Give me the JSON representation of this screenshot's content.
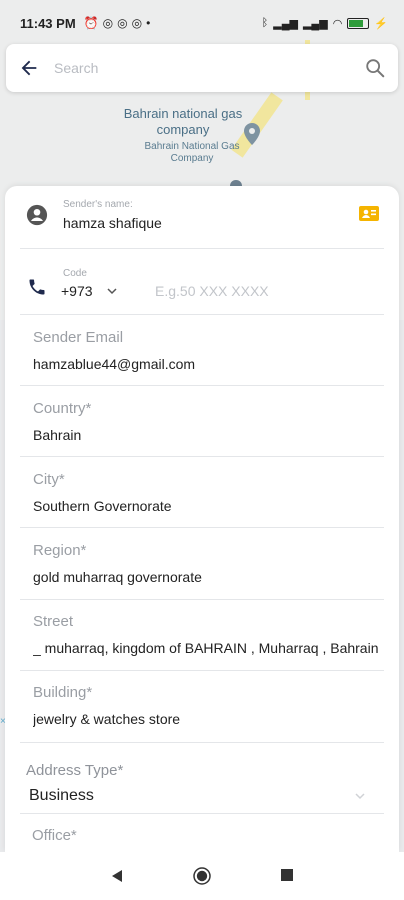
{
  "status_bar": {
    "time": "11:43 PM",
    "battery_level": 0.8,
    "battery_color": "#2e9c3a"
  },
  "map": {
    "poi_title": "Bahrain national gas company",
    "poi_subtitle": "Bahrain National Gas Company"
  },
  "search": {
    "placeholder": "Search",
    "value": ""
  },
  "sender": {
    "name_label": "Sender's name:",
    "name_value": "hamza shafique",
    "code_label": "Code",
    "code_value": "+973",
    "phone_placeholder": "E.g.50 XXX XXXX",
    "phone_value": ""
  },
  "fields": [
    {
      "label": "Sender Email",
      "value": "hamzablue44@gmail.com"
    },
    {
      "label": "Country*",
      "value": "Bahrain"
    },
    {
      "label": "City*",
      "value": "Southern Governorate"
    },
    {
      "label": "Region*",
      "value": "gold muharraq governorate"
    },
    {
      "label": "Street",
      "value": "_ muharraq, kingdom of BAHRAIN , Muharraq , Bahrain"
    },
    {
      "label": "Building*",
      "value": "jewelry & watches store"
    }
  ],
  "address_type": {
    "label": "Address Type*",
    "value": "Business"
  },
  "office": {
    "label": "Office*"
  },
  "colors": {
    "accent_yellow": "#f5b400",
    "icon_dark": "#1f2a4d"
  }
}
